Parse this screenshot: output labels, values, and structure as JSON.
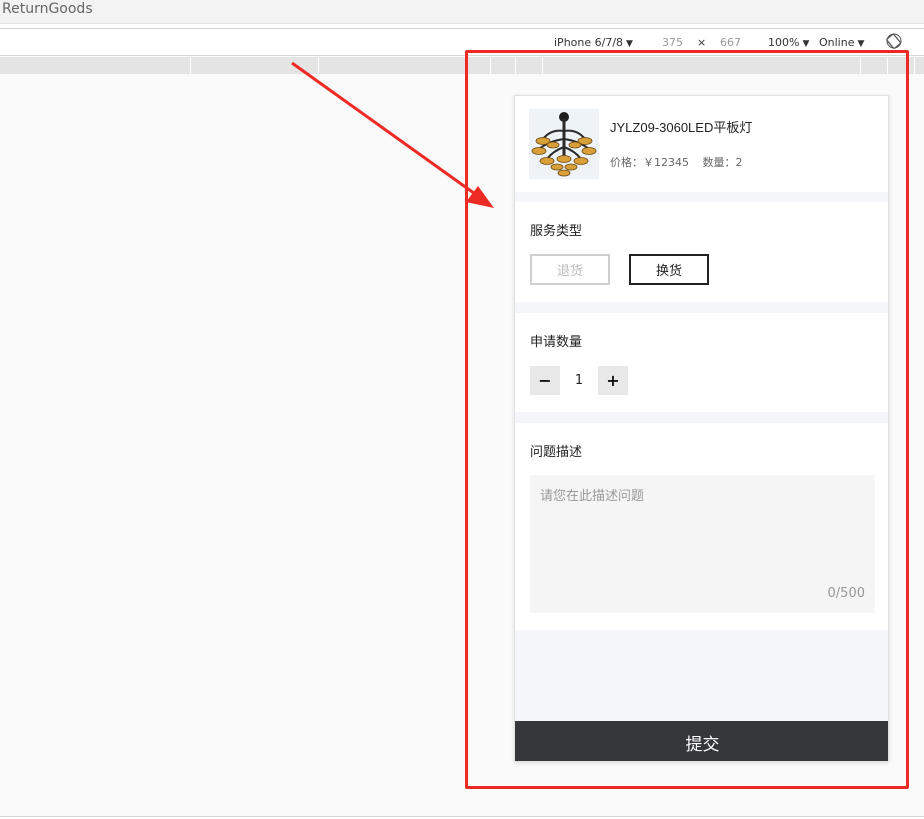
{
  "window": {
    "title": "ReturnGoods"
  },
  "devtools": {
    "device": "iPhone 6/7/8",
    "width": "375",
    "times": "×",
    "height": "667",
    "zoom": "100%",
    "network": "Online"
  },
  "product": {
    "name": "JYLZ09-3060LED平板灯",
    "price": "价格：￥12345",
    "quantity": "数量：2"
  },
  "service_type": {
    "title": "服务类型",
    "options": [
      "退货",
      "换货"
    ],
    "selected": "换货"
  },
  "apply_quantity": {
    "title": "申请数量",
    "minus": "−",
    "value": "1",
    "plus": "+"
  },
  "description": {
    "title": "问题描述",
    "placeholder": "请您在此描述问题",
    "counter": "0/500"
  },
  "submit_label": "提交",
  "colors": {
    "annotation": "#ee2a24",
    "submit_bg": "#36373a",
    "page_bg": "#f5f6fa"
  }
}
